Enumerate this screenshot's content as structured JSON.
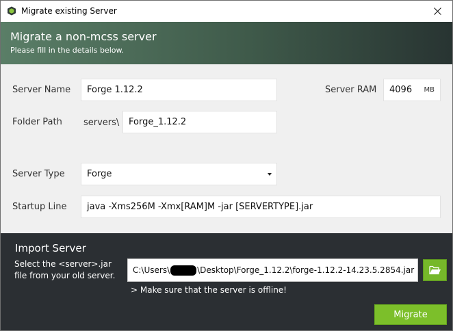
{
  "window": {
    "title": "Migrate existing Server"
  },
  "header": {
    "title": "Migrate a non-mcss server",
    "subtitle": "Please fill in the details below."
  },
  "form": {
    "server_name_label": "Server Name",
    "server_name_value": "Forge 1.12.2",
    "server_ram_label": "Server RAM",
    "server_ram_value": "4096",
    "server_ram_unit": "MB",
    "folder_path_label": "Folder Path",
    "folder_prefix": "servers\\",
    "folder_value": "Forge_1.12.2",
    "server_type_label": "Server Type",
    "server_type_selected": "Forge",
    "startup_line_label": "Startup Line",
    "startup_line_value": "java -Xms256M -Xmx[RAM]M -jar [SERVERTYPE].jar"
  },
  "import": {
    "title": "Import Server",
    "description": "Select the <server>.jar file from your old server.",
    "path_before": "C:\\Users\\",
    "path_after": "\\Desktop\\Forge_1.12.2\\forge-1.12.2-14.23.5.2854.jar",
    "offline_note": "> Make sure that the server is offline!",
    "migrate_label": "Migrate"
  },
  "colors": {
    "accent_green": "#7cbf2a",
    "import_bg": "#2b2f33",
    "header_gradient_start": "#5a7e67",
    "header_gradient_end": "#283432"
  }
}
